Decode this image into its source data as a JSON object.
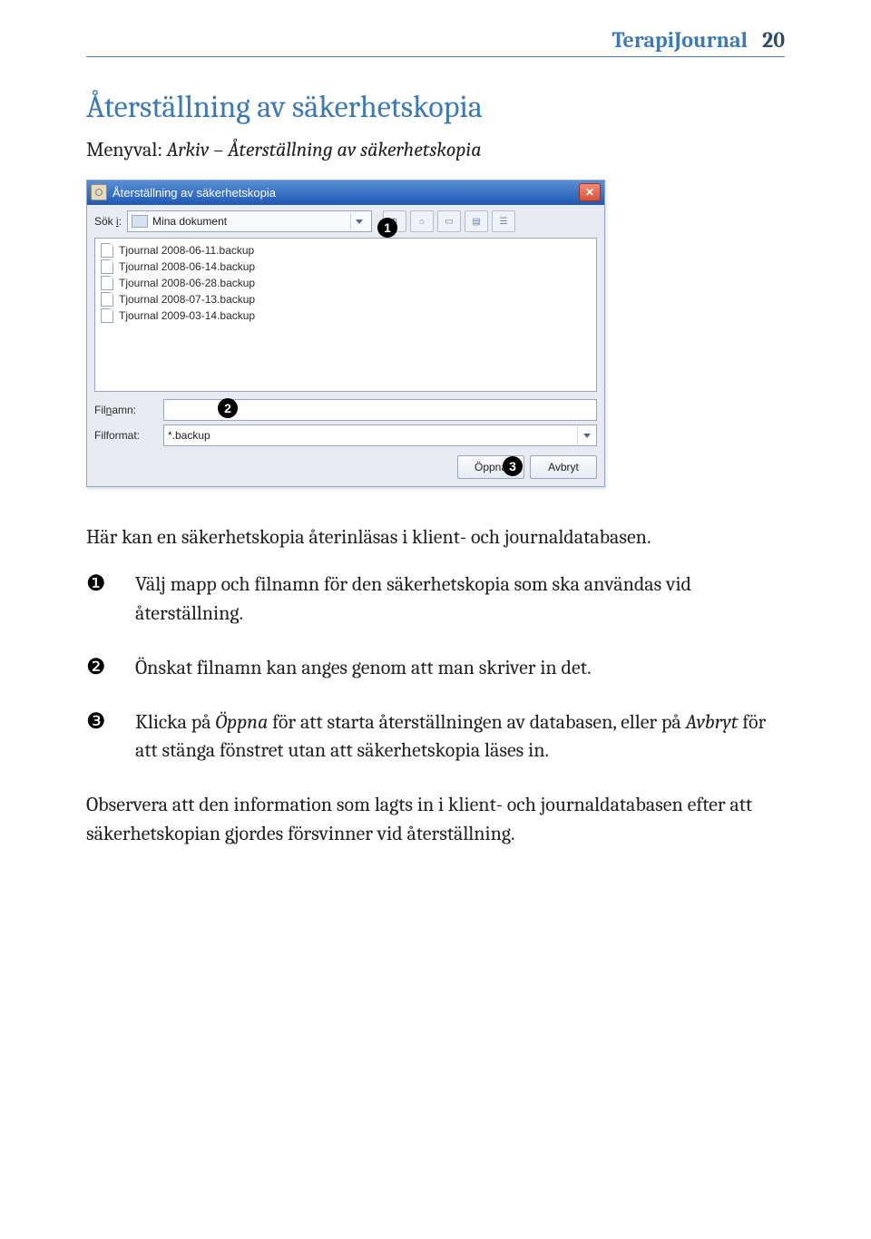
{
  "header": {
    "title": "TerapiJournal",
    "page_number": "20"
  },
  "section": {
    "title": "Återställning av säkerhetskopia",
    "menuval_label": "Menyval: ",
    "menuval_path": "Arkiv – Återställning av säkerhetskopia"
  },
  "dialog": {
    "title": "Återställning av säkerhetskopia",
    "sok_label_prefix": "Sök ",
    "sok_label_underline": "i",
    "sok_label_suffix": ":",
    "sok_value": "Mina dokument",
    "files": [
      "Tjournal 2008-06-11.backup",
      "Tjournal 2008-06-14.backup",
      "Tjournal 2008-06-28.backup",
      "Tjournal 2008-07-13.backup",
      "Tjournal 2009-03-14.backup"
    ],
    "filnamn_label_prefix": "Fil",
    "filnamn_label_underline": "n",
    "filnamn_label_suffix": "amn:",
    "filnamn_value": "",
    "filformat_label": "Filformat:",
    "filformat_value": "*.backup",
    "open_label": "Öppna",
    "cancel_label": "Avbryt",
    "marker1": "1",
    "marker2": "2",
    "marker3": "3"
  },
  "intro_text": "Här kan en säkerhetskopia återinläsas i klient- och journaldatabasen.",
  "steps": [
    {
      "bullet": "❶",
      "text": "Välj mapp och filnamn för den säkerhetskopia som ska användas vid återställning."
    },
    {
      "bullet": "❷",
      "text": "Önskat filnamn kan anges genom att man skriver in det."
    },
    {
      "bullet": "❸",
      "text_pre": "Klicka på ",
      "italic1": "Öppna",
      "text_mid": " för att starta återställningen av databasen, eller på ",
      "italic2": "Avbryt",
      "text_post": " för att stänga fönstret utan att säkerhetskopia läses in."
    }
  ],
  "note_text": "Observera att den information som lagts in i klient- och journaldatabasen efter att säkerhetskopian gjordes försvinner vid återställning."
}
